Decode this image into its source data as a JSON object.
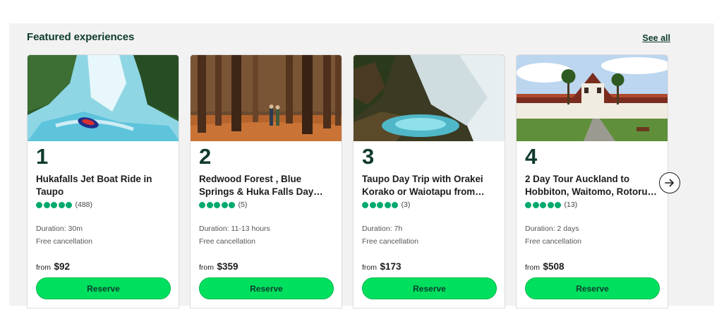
{
  "section": {
    "title": "Featured experiences",
    "see_all_label": "See all"
  },
  "cards": [
    {
      "rank": "1",
      "title": "Hukafalls Jet Boat Ride in Taupo",
      "rating_bubbles": 5,
      "review_count": "(488)",
      "duration": "Duration: 30m",
      "cancellation": "Free cancellation",
      "price_prefix": "from",
      "price": "$92",
      "reserve_label": "Reserve"
    },
    {
      "rank": "2",
      "title": "Redwood Forest , Blue Springs & Huka Falls Day…",
      "rating_bubbles": 5,
      "review_count": "(5)",
      "duration": "Duration: 11-13 hours",
      "cancellation": "Free cancellation",
      "price_prefix": "from",
      "price": "$359",
      "reserve_label": "Reserve"
    },
    {
      "rank": "3",
      "title": "Taupo Day Trip with Orakei Korako or Waiotapu from…",
      "rating_bubbles": 5,
      "review_count": "(3)",
      "duration": "Duration: 7h",
      "cancellation": "Free cancellation",
      "price_prefix": "from",
      "price": "$173",
      "reserve_label": "Reserve"
    },
    {
      "rank": "4",
      "title": "2 Day Tour Auckland to Hobbiton, Waitomo, Rotoru…",
      "rating_bubbles": 5,
      "review_count": "(13)",
      "duration": "Duration: 2 days",
      "cancellation": "Free cancellation",
      "price_prefix": "from",
      "price": "$508",
      "reserve_label": "Reserve"
    }
  ],
  "icons": {
    "next": "chevron-right-circle-icon"
  },
  "colors": {
    "brand_dark": "#0f3b2e",
    "reserve_green": "#00e05e",
    "rating_green": "#00aa6c"
  }
}
